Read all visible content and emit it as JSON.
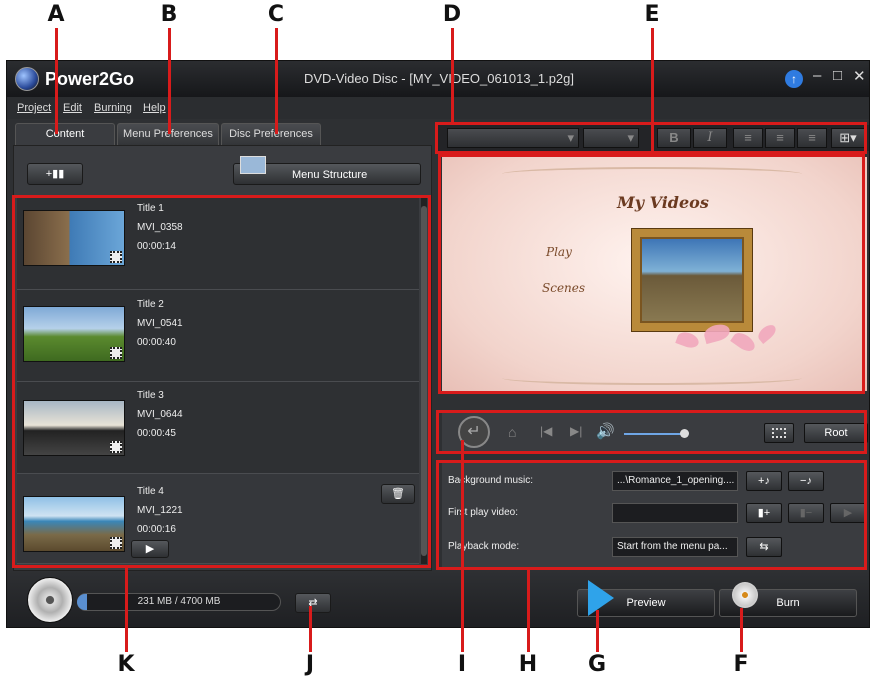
{
  "callouts": {
    "top": [
      "A",
      "B",
      "C",
      "D",
      "E"
    ],
    "bottom": [
      "K",
      "J",
      "I",
      "H",
      "G",
      "F"
    ]
  },
  "app": {
    "name": "Power2Go",
    "title": "DVD-Video Disc - [MY_VIDEO_061013_1.p2g]",
    "window_controls": [
      "–",
      "□",
      "✕"
    ]
  },
  "menu": [
    "Project",
    "Edit",
    "Burning",
    "Help"
  ],
  "tabs": [
    "Content",
    "Menu Preferences",
    "Disc Preferences"
  ],
  "content": {
    "add_label": "+",
    "menu_structure_label": "Menu Structure",
    "titles": [
      {
        "title": "Title 1",
        "file": "MVI_0358",
        "duration": "00:00:14"
      },
      {
        "title": "Title 2",
        "file": "MVI_0541",
        "duration": "00:00:40"
      },
      {
        "title": "Title 3",
        "file": "MVI_0644",
        "duration": "00:00:45"
      },
      {
        "title": "Title 4",
        "file": "MVI_1221",
        "duration": "00:00:16"
      }
    ]
  },
  "format_bar": {
    "bold": "B",
    "italic": "I"
  },
  "menu_preview": {
    "title": "My Videos",
    "items": [
      "Play",
      "Scenes"
    ]
  },
  "playback": {
    "root_label": "Root"
  },
  "disc_settings": {
    "background_music_label": "Background music:",
    "background_music_value": "...\\Romance_1_opening....",
    "first_play_label": "First play video:",
    "first_play_value": "",
    "playback_mode_label": "Playback mode:",
    "playback_mode_value": "Start from the menu pa..."
  },
  "bottom": {
    "capacity": "231 MB / 4700 MB",
    "capacity_used_fraction": 0.049,
    "preview_label": "Preview",
    "burn_label": "Burn"
  },
  "colors": {
    "callout": "#d81b1b",
    "accent": "#2f7be0"
  }
}
